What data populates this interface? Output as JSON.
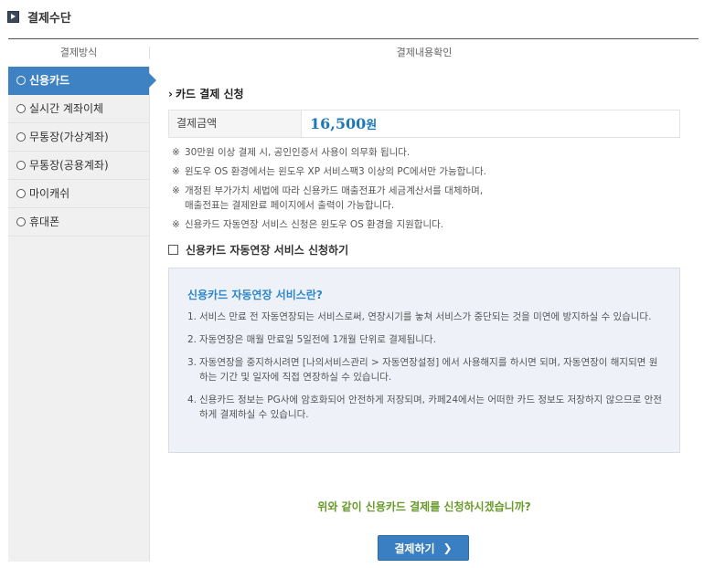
{
  "header": {
    "title": "결제수단"
  },
  "columns": {
    "left": "결제방식",
    "right": "결제내용확인"
  },
  "sidebar": {
    "items": [
      {
        "label": "신용카드",
        "active": true
      },
      {
        "label": "실시간 계좌이체",
        "active": false
      },
      {
        "label": "무통장(가상계좌)",
        "active": false
      },
      {
        "label": "무통장(공용계좌)",
        "active": false
      },
      {
        "label": "마이캐쉬",
        "active": false
      },
      {
        "label": "휴대폰",
        "active": false
      }
    ]
  },
  "main": {
    "section_title": "카드 결제 신청",
    "amount": {
      "label": "결제금액",
      "value": "16,500",
      "unit": "원"
    },
    "notes": [
      {
        "mark": "※",
        "text": "30만원 이상 결제 시, 공인인증서 사용이 의무화 됩니다."
      },
      {
        "mark": "※",
        "text": "윈도우 OS 환경에서는 윈도우 XP 서비스팩3 이상의 PC에서만 가능합니다."
      },
      {
        "mark": "※",
        "text": "개정된 부가가치 세법에 따라 신용카드 매출전표가 세금계산서를 대체하며,\n매출전표는 결제완료 페이지에서 출력이 가능합니다."
      },
      {
        "mark": "※",
        "text": "신용카드 자동연장 서비스 신청은 윈도우 OS 환경을 지원합니다."
      }
    ],
    "auto_renew_label": "신용카드 자동연장 서비스 신청하기",
    "info_box": {
      "title": "신용카드 자동연장 서비스란?",
      "items": [
        {
          "num": "1.",
          "text": "서비스 만료 전 자동연장되는 서비스로써, 연장시기를 놓쳐 서비스가 중단되는 것을 미연에 방지하실 수 있습니다."
        },
        {
          "num": "2.",
          "text": "자동연장은 매월 만료일 5일전에 1개월 단위로 결제됩니다."
        },
        {
          "num": "3.",
          "text": "자동연장을 중지하시려면 [나의서비스관리 > 자동연장설정] 에서 사용해지를 하시면 되며, 자동연장이 해지되면 원하는 기간 및 일자에 직접 연장하실 수 있습니다."
        },
        {
          "num": "4.",
          "text": "신용카드 정보는 PG사에 암호화되어 안전하게 저장되며, 카페24에서는 어떠한 카드 정보도 저장하지 않으므로 안전하게 결제하실 수 있습니다."
        }
      ]
    },
    "confirm_text": "위와 같이 신용카드 결제를 신청하시겠습니까?",
    "pay_button": {
      "label": "결제하기",
      "arrow": "❯"
    }
  },
  "colors": {
    "accent": "#3f82c4",
    "amount": "#1d77b8",
    "confirm": "#679a2a",
    "info_bg": "#eef2f8"
  }
}
